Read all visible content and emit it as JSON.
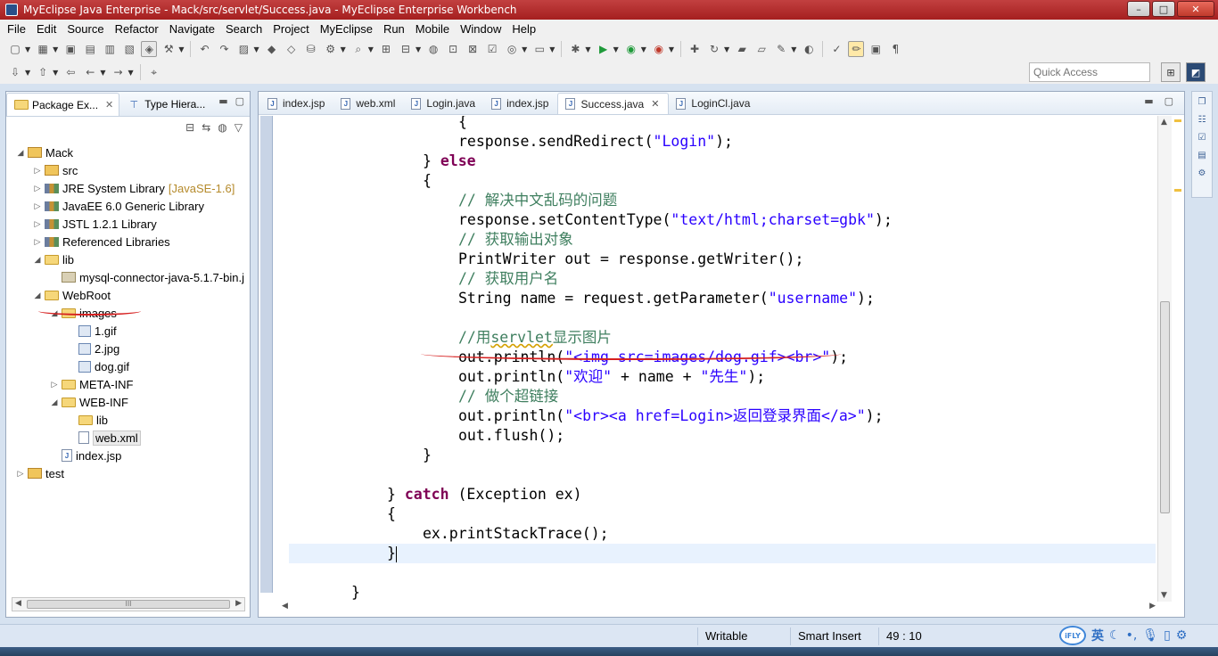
{
  "window": {
    "title": "MyEclipse Java Enterprise - Mack/src/servlet/Success.java - MyEclipse Enterprise Workbench",
    "controls": [
      "–",
      "□",
      "✕"
    ]
  },
  "menu": [
    "File",
    "Edit",
    "Source",
    "Refactor",
    "Navigate",
    "Search",
    "Project",
    "MyEclipse",
    "Run",
    "Mobile",
    "Window",
    "Help"
  ],
  "quick_access": {
    "placeholder": "Quick Access"
  },
  "left_panel": {
    "tabs": [
      {
        "label": "Package Ex...",
        "active": true
      },
      {
        "label": "Type Hiera...",
        "active": false
      }
    ],
    "tree": [
      {
        "label": "Mack",
        "icon": "project",
        "level": 0,
        "twisty": "expanded"
      },
      {
        "label": "src",
        "icon": "project",
        "level": 1,
        "twisty": "collapsed"
      },
      {
        "label": "JRE System Library",
        "decor": "[JavaSE-1.6]",
        "icon": "lib",
        "level": 1,
        "twisty": "collapsed"
      },
      {
        "label": "JavaEE 6.0 Generic Library",
        "icon": "lib",
        "level": 1,
        "twisty": "collapsed"
      },
      {
        "label": "JSTL 1.2.1 Library",
        "icon": "lib",
        "level": 1,
        "twisty": "collapsed"
      },
      {
        "label": "Referenced Libraries",
        "icon": "lib",
        "level": 1,
        "twisty": "collapsed"
      },
      {
        "label": "lib",
        "icon": "folder",
        "level": 1,
        "twisty": "expanded"
      },
      {
        "label": "mysql-connector-java-5.1.7-bin.j",
        "icon": "jar",
        "level": 2,
        "twisty": ""
      },
      {
        "label": "WebRoot",
        "icon": "folder",
        "level": 1,
        "twisty": "expanded"
      },
      {
        "label": "images",
        "icon": "folder",
        "level": 2,
        "twisty": "expanded"
      },
      {
        "label": "1.gif",
        "icon": "img",
        "level": 3,
        "twisty": ""
      },
      {
        "label": "2.jpg",
        "icon": "img",
        "level": 3,
        "twisty": ""
      },
      {
        "label": "dog.gif",
        "icon": "img",
        "level": 3,
        "twisty": ""
      },
      {
        "label": "META-INF",
        "icon": "folder",
        "level": 2,
        "twisty": "collapsed"
      },
      {
        "label": "WEB-INF",
        "icon": "folder",
        "level": 2,
        "twisty": "expanded"
      },
      {
        "label": "lib",
        "icon": "folder",
        "level": 3,
        "twisty": ""
      },
      {
        "label": "web.xml",
        "icon": "xml",
        "level": 3,
        "twisty": "",
        "highlight": true
      },
      {
        "label": "index.jsp",
        "icon": "file",
        "level": 2,
        "twisty": ""
      },
      {
        "label": "test",
        "icon": "project",
        "level": 0,
        "twisty": "collapsed"
      }
    ],
    "scroll_label": "III"
  },
  "editor": {
    "tabs": [
      {
        "label": "index.jsp",
        "active": false
      },
      {
        "label": "web.xml",
        "active": false
      },
      {
        "label": "Login.java",
        "active": false
      },
      {
        "label": "index.jsp",
        "active": false
      },
      {
        "label": "Success.java",
        "active": true
      },
      {
        "label": "LoginCl.java",
        "active": false
      }
    ],
    "lines": [
      {
        "indent": 16,
        "tokens": [
          {
            "t": "{",
            "c": ""
          }
        ]
      },
      {
        "indent": 16,
        "tokens": [
          {
            "t": "response.sendRedirect(",
            "c": ""
          },
          {
            "t": "\"Login\"",
            "c": "str"
          },
          {
            "t": ");",
            "c": ""
          }
        ]
      },
      {
        "indent": 12,
        "tokens": [
          {
            "t": "} ",
            "c": ""
          },
          {
            "t": "else",
            "c": "kw"
          }
        ]
      },
      {
        "indent": 12,
        "tokens": [
          {
            "t": "{",
            "c": ""
          }
        ]
      },
      {
        "indent": 16,
        "tokens": [
          {
            "t": "// 解决中文乱码的问题",
            "c": "cmt"
          }
        ]
      },
      {
        "indent": 16,
        "tokens": [
          {
            "t": "response.setContentType(",
            "c": ""
          },
          {
            "t": "\"text/html;charset=gbk\"",
            "c": "str"
          },
          {
            "t": ");",
            "c": ""
          }
        ]
      },
      {
        "indent": 16,
        "tokens": [
          {
            "t": "// 获取输出对象",
            "c": "cmt"
          }
        ]
      },
      {
        "indent": 16,
        "tokens": [
          {
            "t": "PrintWriter out = response.getWriter();",
            "c": ""
          }
        ]
      },
      {
        "indent": 16,
        "tokens": [
          {
            "t": "// 获取用户名",
            "c": "cmt"
          }
        ]
      },
      {
        "indent": 16,
        "tokens": [
          {
            "t": "String name = request.getParameter(",
            "c": ""
          },
          {
            "t": "\"username\"",
            "c": "str"
          },
          {
            "t": ");",
            "c": ""
          }
        ]
      },
      {
        "indent": 0,
        "tokens": []
      },
      {
        "indent": 16,
        "tokens": [
          {
            "t": "//用",
            "c": "cmt"
          },
          {
            "t": "servlet",
            "c": "cmt under"
          },
          {
            "t": "显示图片",
            "c": "cmt"
          }
        ]
      },
      {
        "indent": 16,
        "tokens": [
          {
            "t": "out.println(",
            "c": ""
          },
          {
            "t": "\"<img src=images/dog.gif><br>\"",
            "c": "str"
          },
          {
            "t": ");",
            "c": ""
          }
        ]
      },
      {
        "indent": 16,
        "tokens": [
          {
            "t": "out.println(",
            "c": ""
          },
          {
            "t": "\"欢迎\"",
            "c": "str"
          },
          {
            "t": " + name + ",
            "c": ""
          },
          {
            "t": "\"先生\"",
            "c": "str"
          },
          {
            "t": ");",
            "c": ""
          }
        ]
      },
      {
        "indent": 16,
        "tokens": [
          {
            "t": "// 做个超链接",
            "c": "cmt"
          }
        ]
      },
      {
        "indent": 16,
        "tokens": [
          {
            "t": "out.println(",
            "c": ""
          },
          {
            "t": "\"<br><a href=Login>返回登录界面</a>\"",
            "c": "str"
          },
          {
            "t": ");",
            "c": ""
          }
        ]
      },
      {
        "indent": 16,
        "tokens": [
          {
            "t": "out.flush();",
            "c": ""
          }
        ]
      },
      {
        "indent": 12,
        "tokens": [
          {
            "t": "}",
            "c": ""
          }
        ]
      },
      {
        "indent": 0,
        "tokens": []
      },
      {
        "indent": 8,
        "tokens": [
          {
            "t": "} ",
            "c": ""
          },
          {
            "t": "catch",
            "c": "kw"
          },
          {
            "t": " (Exception ex)",
            "c": ""
          }
        ]
      },
      {
        "indent": 8,
        "tokens": [
          {
            "t": "{",
            "c": ""
          }
        ]
      },
      {
        "indent": 12,
        "tokens": [
          {
            "t": "ex.printStackTrace();",
            "c": ""
          }
        ]
      },
      {
        "indent": 8,
        "tokens": [
          {
            "t": "}",
            "c": ""
          }
        ],
        "current": true
      },
      {
        "indent": 0,
        "tokens": []
      },
      {
        "indent": 4,
        "tokens": [
          {
            "t": "}",
            "c": ""
          }
        ]
      }
    ]
  },
  "status": {
    "writable": "Writable",
    "insert_mode": "Smart Insert",
    "position": "49 : 10"
  },
  "ime": {
    "logo": "iFLY",
    "lang": "英"
  },
  "colors": {
    "title_bar": "#b52a2a",
    "keyword": "#7f0055",
    "string": "#2a00ff",
    "comment": "#3f7f5f",
    "current_line": "#e8f2fe",
    "annotation": "#d61f1f"
  }
}
